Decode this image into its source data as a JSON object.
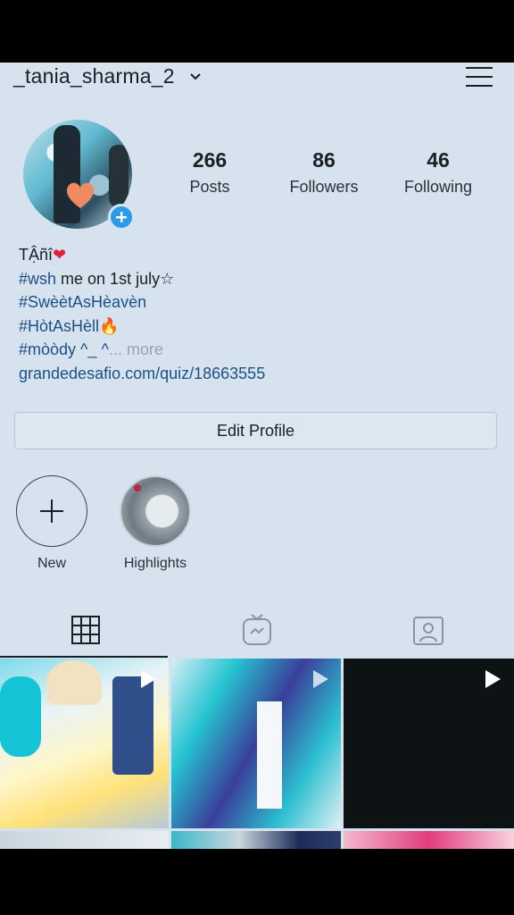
{
  "profile": {
    "username": "_tania_sharma_2",
    "stats": [
      {
        "value": "266",
        "label": "Posts"
      },
      {
        "value": "86",
        "label": "Followers"
      },
      {
        "value": "46",
        "label": "Following"
      }
    ],
    "bio": {
      "name": "TẬñî",
      "name_emoji": "❤",
      "line1_tag": "#wsh",
      "line1_rest": " me on 1st july☆",
      "line2": "#SwèètAsHèavèn",
      "line3": "#HòtAsHèll",
      "line3_emoji": "🔥",
      "line4": "#mòòdy ^_ ^",
      "line4_more": "... more",
      "link": "grandedesafio.com/quiz/18663555"
    },
    "edit_label": "Edit Profile"
  },
  "highlights": [
    {
      "label": "New"
    },
    {
      "label": "Highlights"
    }
  ],
  "tabs": [
    "grid-icon",
    "igtv-icon",
    "tagged-icon"
  ],
  "colors": {
    "background": "#d6e3ef",
    "link": "#1d4f87",
    "badge": "#2a9bea"
  }
}
